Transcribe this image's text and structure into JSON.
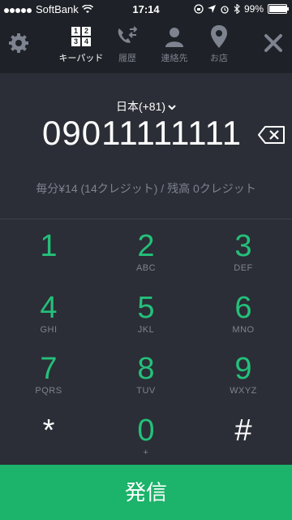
{
  "status_bar": {
    "carrier": "SoftBank",
    "time": "17:14",
    "battery": "99%",
    "battery_level": 0.99
  },
  "nav": {
    "tabs": [
      {
        "label": "キーパッド",
        "icon": "keypad-icon"
      },
      {
        "label": "履歴",
        "icon": "call-history-icon"
      },
      {
        "label": "連絡先",
        "icon": "contacts-icon"
      },
      {
        "label": "お店",
        "icon": "location-pin-icon"
      }
    ],
    "keypad_icon_digits": [
      "1",
      "2",
      "3",
      "4"
    ]
  },
  "dial": {
    "country": "日本(+81)",
    "number": "09011111111",
    "rate": "毎分¥14 (14クレジット) / 残高 0クレジット"
  },
  "keypad": [
    {
      "digit": "1",
      "letters": ""
    },
    {
      "digit": "2",
      "letters": "ABC"
    },
    {
      "digit": "3",
      "letters": "DEF"
    },
    {
      "digit": "4",
      "letters": "GHI"
    },
    {
      "digit": "5",
      "letters": "JKL"
    },
    {
      "digit": "6",
      "letters": "MNO"
    },
    {
      "digit": "7",
      "letters": "PQRS"
    },
    {
      "digit": "8",
      "letters": "TUV"
    },
    {
      "digit": "9",
      "letters": "WXYZ"
    },
    {
      "digit": "*",
      "letters": ""
    },
    {
      "digit": "0",
      "letters": "+"
    },
    {
      "digit": "#",
      "letters": ""
    }
  ],
  "call_button": "発信",
  "colors": {
    "accent_green": "#24c07a",
    "call_button": "#1cb36a",
    "background": "#2b2e36",
    "header": "#1e2127"
  }
}
